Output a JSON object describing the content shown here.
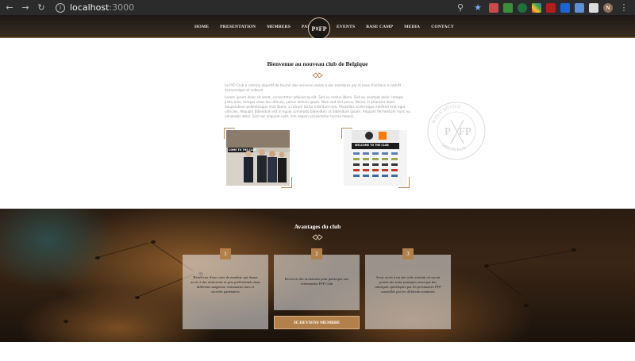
{
  "browser": {
    "url_host": "localhost",
    "url_port": ":3000",
    "profile_initial": "N"
  },
  "nav": {
    "left": [
      "HOME",
      "PRESENTATION",
      "MEMBERS",
      "PARTNERS"
    ],
    "right": [
      "EVENTS",
      "BASE CAMP",
      "MEDIA",
      "CONTACT"
    ],
    "logo_text": "P☓FP"
  },
  "intro": {
    "title": "Bienvenue au nouveau club de Belgique",
    "para1": "Le PFP Club a comme objectif de fournir des services variés à ses membres par le biais d'actions à intérêt économique et culturel.",
    "para2": "Lorem ipsum dolor sit amet, consectetur adipiscing elit. Sed eu metus libero. Sed eu volutpat dolor. Integer justo eros, tempor vitae leo ultrices, varius dictum quam. Nam sed nisl purus. Donec in pharetra dolor. Suspendisse pellentesque erat libero, a rutrum tortor interdum non. Phasellus scelerisque eleifend erat eget ultricies. Aliquam bibendum est in ligula commodo bibendum ut bibendum ipsum. Aliquam fermentum nunc eu venenatis dolor. Sed nec aliquam velit, non sapien consectetur lacinia mauris.",
    "photo_banner": "COME TO THE CLUB",
    "photo2_banner": "WELCOME TO THE CLUB",
    "stamp_top": "WHEN ADVICE",
    "stamp_bottom": "MEETS FUN"
  },
  "advantages": {
    "title": "Avantages du club",
    "cards": [
      {
        "num": "1",
        "text": "Bénéficier d'une carte de membre qui donne accès à des réductions et prix préférentiels dans différents magasins, restaurants, bars et sociétés partenaires"
      },
      {
        "num": "2",
        "text": "Recevoir des invitations pour participer aux événements PFP Club"
      },
      {
        "num": "3",
        "text": "Avoir accès à un site web restreint où seront postés des infos pratiques ainsi que des rubriques spécifiques par les prestataires PFP conseillés par les différents membres"
      }
    ],
    "cta": "JE DEVIENS MEMBRE"
  },
  "colors": {
    "accent": "#b2804a",
    "nav_bg": "#2d251d"
  }
}
